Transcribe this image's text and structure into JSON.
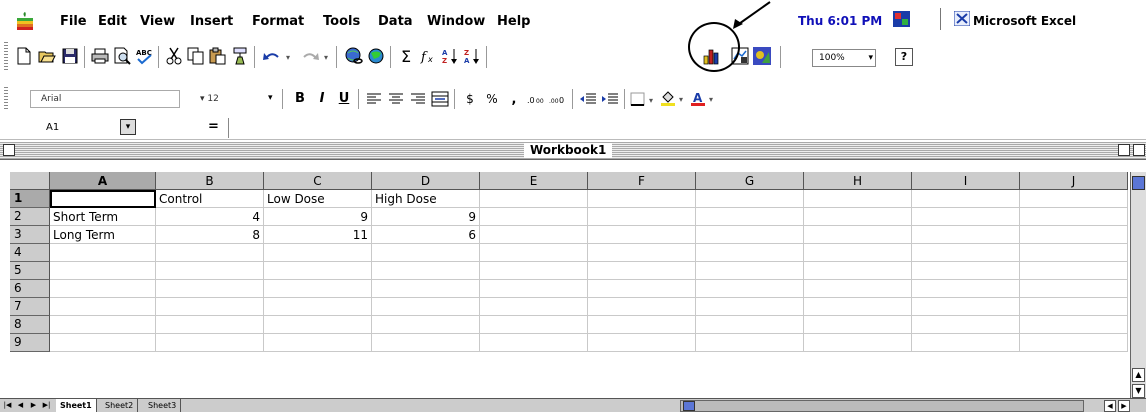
{
  "menubar": {
    "items": [
      "File",
      "Edit",
      "View",
      "Insert",
      "Format",
      "Tools",
      "Data",
      "Window",
      "Help"
    ],
    "clock": "Thu 6:01 PM",
    "app_name": "Microsoft Excel"
  },
  "standard_toolbar": {
    "zoom": "100%",
    "icons": [
      "new-icon",
      "open-icon",
      "save-icon",
      "print-icon",
      "print-preview-icon",
      "spelling-icon",
      "cut-icon",
      "copy-icon",
      "paste-icon",
      "format-painter-icon",
      "undo-icon",
      "redo-icon",
      "hyperlink-icon",
      "web-toolbar-icon",
      "autosum-icon",
      "paste-function-icon",
      "sort-ascending-icon",
      "sort-descending-icon",
      "chart-wizard-icon",
      "map-icon",
      "drawing-icon",
      "help-icon"
    ],
    "highlighted": "chart-wizard-icon"
  },
  "formatting_toolbar": {
    "font": "Arial",
    "size": "12",
    "bold": "B",
    "italic": "I",
    "underline": "U"
  },
  "formula_bar": {
    "name_box": "A1",
    "equals": "=",
    "content": ""
  },
  "workbook": {
    "title": "Workbook1",
    "columns": [
      "A",
      "B",
      "C",
      "D",
      "E",
      "F",
      "G",
      "H",
      "I",
      "J"
    ],
    "rows": [
      "1",
      "2",
      "3",
      "4",
      "5",
      "6",
      "7",
      "8",
      "9"
    ],
    "cells": {
      "B1": "Control",
      "C1": "Low Dose",
      "D1": "High Dose",
      "A2": "Short Term",
      "B2": "4",
      "C2": "9",
      "D2": "9",
      "A3": "Long Term",
      "B3": "8",
      "C3": "11",
      "D3": "6"
    }
  },
  "sheet_tabs": [
    "Sheet1",
    "Sheet2",
    "Sheet3"
  ],
  "active_sheet": "Sheet1"
}
